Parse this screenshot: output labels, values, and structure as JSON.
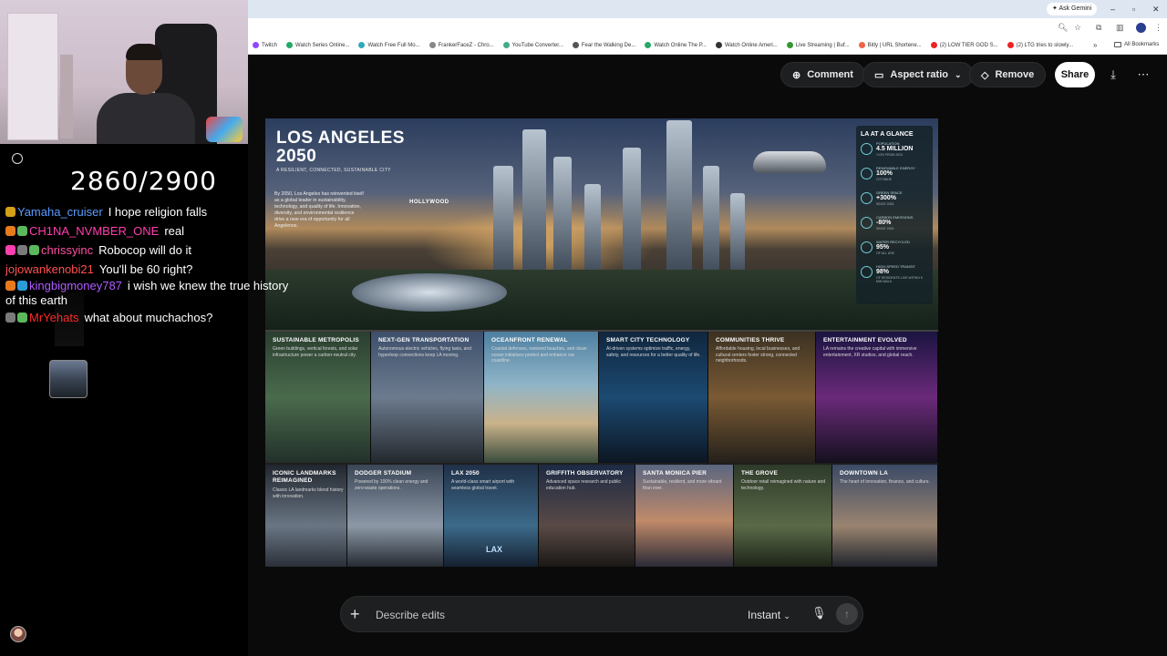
{
  "browser": {
    "ask_gemini": "Ask Gemini",
    "bookmarks": [
      {
        "label": "Twitch",
        "color": "#9146ff"
      },
      {
        "label": "Watch Series Online...",
        "color": "#2a6"
      },
      {
        "label": "Watch Free Full Mo...",
        "color": "#3ab"
      },
      {
        "label": "FrankerFaceZ - Chro...",
        "color": "#888"
      },
      {
        "label": "YouTube Converter...",
        "color": "#4a8"
      },
      {
        "label": "Fear the Walking De...",
        "color": "#555"
      },
      {
        "label": "Watch Online The P...",
        "color": "#2a6"
      },
      {
        "label": "Watch Online Ameri...",
        "color": "#333"
      },
      {
        "label": "Live Streaming | Buf...",
        "color": "#393"
      },
      {
        "label": "Bitly | URL Shortene...",
        "color": "#e64"
      },
      {
        "label": "(2) LOW TIER GOD S...",
        "color": "#e22"
      },
      {
        "label": "(2) LTG tries to slowly...",
        "color": "#e22"
      }
    ],
    "all_bookmarks": "All Bookmarks"
  },
  "toolbar": {
    "comment": "Comment",
    "aspect_ratio": "Aspect ratio",
    "remove": "Remove",
    "share": "Share"
  },
  "poster": {
    "title_line1": "LOS ANGELES",
    "title_line2": "2050",
    "subtitle": "A RESILIENT, CONNECTED, SUSTAINABLE CITY",
    "body": "By 2050, Los Angeles has reinvented itself as a global leader in sustainability, technology, and quality of life. Innovation, diversity, and environmental resilience drive a new era of opportunity for all Angelenos.",
    "hollywood": "HOLLYWOOD",
    "glance": {
      "title": "LA AT A GLANCE",
      "stats": [
        {
          "label": "POPULATION",
          "value": "4.5 MILLION",
          "sub": "+12% FROM 2024"
        },
        {
          "label": "RENEWABLE ENERGY",
          "value": "100%",
          "sub": "CITYWIDE"
        },
        {
          "label": "GREEN SPACE",
          "value": "+300%",
          "sub": "SINCE 2024"
        },
        {
          "label": "CARBON EMISSIONS",
          "value": "-80%",
          "sub": "SINCE 2024"
        },
        {
          "label": "WATER RECYCLED",
          "value": "95%",
          "sub": "OF ALL USE"
        },
        {
          "label": "HIGH-SPEED TRANSIT",
          "value": "98%",
          "sub": "OF RESIDENTS LIVE WITHIN 5 MIN WALK"
        }
      ]
    },
    "row1": [
      {
        "title": "SUSTAINABLE METROPOLIS",
        "text": "Green buildings, vertical forests, and solar infrastructure power a carbon-neutral city."
      },
      {
        "title": "NEXT-GEN TRANSPORTATION",
        "text": "Autonomous electric vehicles, flying taxis, and hyperloop connections keep LA moving."
      },
      {
        "title": "OCEANFRONT RENEWAL",
        "text": "Coastal defenses, restored beaches, and clean ocean initiatives protect and enhance our coastline."
      },
      {
        "title": "SMART CITY TECHNOLOGY",
        "text": "AI-driven systems optimize traffic, energy, safety, and resources for a better quality of life."
      },
      {
        "title": "COMMUNITIES THRIVE",
        "text": "Affordable housing, local businesses, and cultural centers foster strong, connected neighborhoods."
      },
      {
        "title": "ENTERTAINMENT EVOLVED",
        "text": "LA remains the creative capital with immersive entertainment, XR studios, and global reach."
      }
    ],
    "row2": [
      {
        "title": "ICONIC LANDMARKS REIMAGINED",
        "text": "Classic LA landmarks blend history with innovation."
      },
      {
        "title": "DODGER STADIUM",
        "text": "Powered by 100% clean energy and zero-waste operations."
      },
      {
        "title": "LAX 2050",
        "text": "A world-class smart airport with seamless global travel."
      },
      {
        "title": "GRIFFITH OBSERVATORY",
        "text": "Advanced space research and public education hub."
      },
      {
        "title": "SANTA MONICA PIER",
        "text": "Sustainable, resilient, and more vibrant than ever."
      },
      {
        "title": "THE GROVE",
        "text": "Outdoor retail reimagined with nature and technology."
      },
      {
        "title": "DOWNTOWN LA",
        "text": "The heart of innovation, finance, and culture."
      }
    ],
    "lax_sign": "LAX"
  },
  "stream": {
    "counter": "2860/2900",
    "chat": [
      {
        "user": "Yamaha_cruiser",
        "color": "#5b9bff",
        "text": "I hope religion falls",
        "badges": [
          "#d4a017"
        ]
      },
      {
        "user": "CH1NA_NVMBER_ONE",
        "color": "#ff3fae",
        "text": "real",
        "badges": [
          "#e87a1e",
          "#5cb85c"
        ]
      },
      {
        "user": "chrissyinc",
        "color": "#ff4fa3",
        "text": "Robocop will do it",
        "badges": [
          "#ff3fae",
          "#7a7a7a",
          "#5cb85c"
        ]
      },
      {
        "user": "jojowankenobi21",
        "color": "#ff4f4f",
        "text": "You'll be 60 right?",
        "badges": []
      },
      {
        "user": "kingbigmoney787",
        "color": "#b05cff",
        "text": "i wish we knew the true history of this earth",
        "badges": [
          "#e87a1e",
          "#2a9dd8"
        ]
      },
      {
        "user": "MrYehats",
        "color": "#ff2a2a",
        "text": "what about muchachos?",
        "badges": [
          "#7a7a7a",
          "#5cb85c"
        ]
      }
    ]
  },
  "composer": {
    "placeholder": "Describe edits",
    "mode": "Instant"
  }
}
